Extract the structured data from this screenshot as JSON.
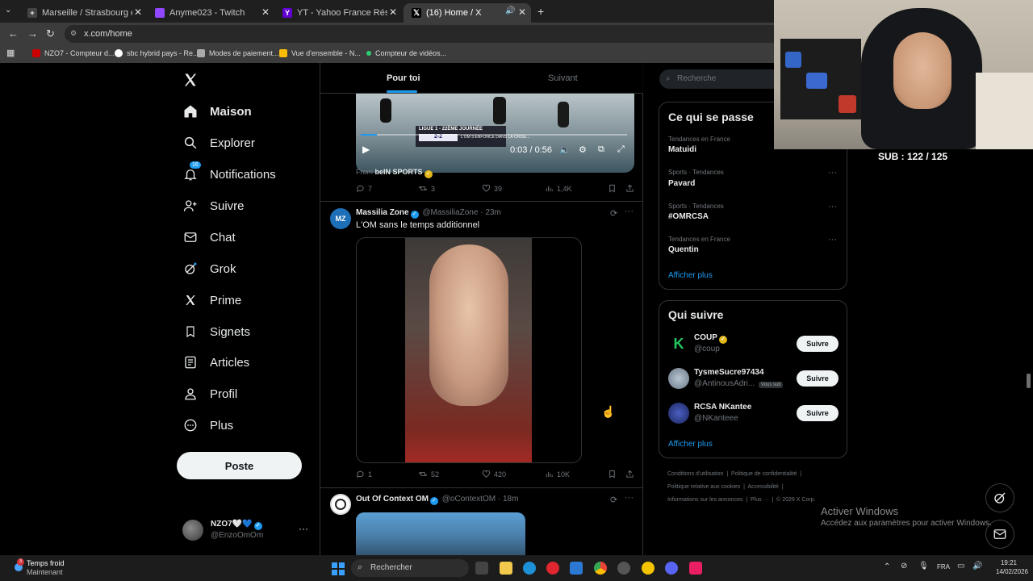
{
  "browser": {
    "tabs": [
      {
        "title": "Marseille / Strasbourg en strea",
        "color": "#333333"
      },
      {
        "title": "Anyme023 - Twitch",
        "color": "#9146ff"
      },
      {
        "title": "YT - Yahoo France Résultats de",
        "color": "#6001d2"
      },
      {
        "title": "(16) Home / X",
        "color": "#000000"
      }
    ],
    "url": "x.com/home",
    "bookmarks": [
      "NZO7 - Compteur d...",
      "sbc hybrid pays - Re...",
      "Modes de paiement...",
      "Vue d'ensemble - N...",
      "Compteur de vidéos..."
    ]
  },
  "nav": {
    "items": [
      {
        "label": "Maison",
        "icon": "home-icon"
      },
      {
        "label": "Explorer",
        "icon": "search-icon"
      },
      {
        "label": "Notifications",
        "icon": "bell-icon",
        "badge": "16"
      },
      {
        "label": "Suivre",
        "icon": "add-user-icon"
      },
      {
        "label": "Chat",
        "icon": "mail-icon"
      },
      {
        "label": "Grok",
        "icon": "grok-icon"
      },
      {
        "label": "Prime",
        "icon": "x-icon"
      },
      {
        "label": "Signets",
        "icon": "bookmark-icon"
      },
      {
        "label": "Articles",
        "icon": "article-icon"
      },
      {
        "label": "Profil",
        "icon": "profile-icon"
      },
      {
        "label": "Plus",
        "icon": "more-icon"
      }
    ],
    "post_label": "Poste",
    "account": {
      "name": "NZO7🤍💙",
      "handle": "@EnzoOmOm"
    }
  },
  "feed": {
    "tabs": [
      "Pour toi",
      "Suivant"
    ],
    "video": {
      "time": "0:03 / 0:56",
      "overlay_title": "LIGUE 1 - 22ÈME JOURNÉE",
      "score": "2-2",
      "headline": "L'OM S'ENFONCE DANS LA CRISE..."
    },
    "from_label": "From",
    "from_source": "beIN SPORTS",
    "tweet1_stats": {
      "replies": "7",
      "retweets": "3",
      "likes": "39",
      "views": "1,4K"
    },
    "tweet2": {
      "name": "Massilia Zone",
      "handle": "@MassiliaZone",
      "time": "23m",
      "text": "L'OM sans le temps additionnel",
      "avatar_text": "MZ",
      "stats": {
        "replies": "1",
        "retweets": "52",
        "likes": "420",
        "views": "10K"
      }
    },
    "tweet3": {
      "name": "Out Of Context OM",
      "handle": "@oContextOM",
      "time": "18m"
    }
  },
  "sidebar": {
    "search_placeholder": "Recherche",
    "trends_title": "Ce qui se passe",
    "trends": [
      {
        "category": "Tendances en France",
        "name": "Matuidi"
      },
      {
        "category": "Sports · Tendances",
        "name": "Pavard"
      },
      {
        "category": "Sports · Tendances",
        "name": "#OMRCSA"
      },
      {
        "category": "Tendances en France",
        "name": "Quentin"
      }
    ],
    "show_more": "Afficher plus",
    "who_title": "Qui suivre",
    "who": [
      {
        "name": "COUP",
        "handle": "@coup",
        "follow": "Suivre",
        "badge": ""
      },
      {
        "name": "TysmeSucre97434",
        "handle": "@AntinousAdri...",
        "follow": "Suivre",
        "badge": "Vous suit"
      },
      {
        "name": "RCSA NKantee",
        "handle": "@NKanteee",
        "follow": "Suivre",
        "badge": ""
      }
    ],
    "footer": [
      "Conditions d'utilisation",
      "Politique de confidentialité",
      "Politique relative aux cookies",
      "Accessibilité",
      "Informations sur les annonces",
      "Plus ···",
      "© 2026 X Corp."
    ]
  },
  "stream": {
    "sub_count": "SUB : 122 / 125"
  },
  "windows": {
    "activate_title": "Activer Windows",
    "activate_sub": "Accédez aux paramètres pour activer Windows.",
    "weather_title": "Temps froid",
    "weather_sub": "Maintenant",
    "weather_badge": "3",
    "search": "Rechercher",
    "lang": "FRA",
    "time": "19:21",
    "date": "14/02/2026"
  }
}
